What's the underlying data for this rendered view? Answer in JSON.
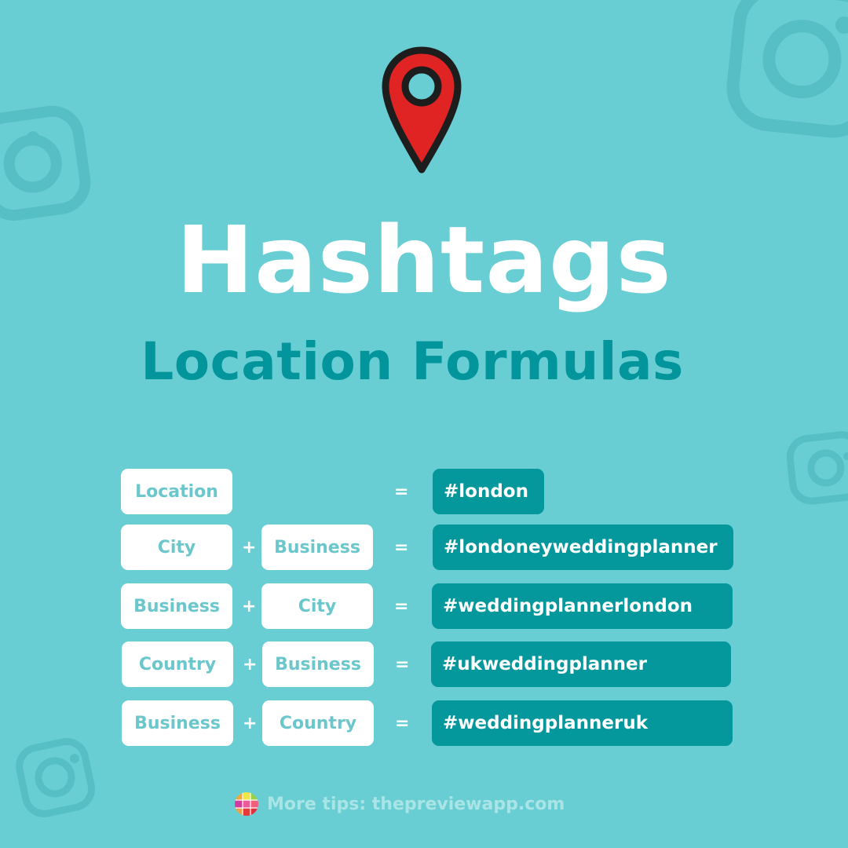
{
  "title": "Hashtags",
  "subtitle": "Location Formulas",
  "colors": {
    "background": "#68ced3",
    "accent_dark": "#04979c",
    "box_text": "#6bc7cc",
    "pin_red": "#e02424"
  },
  "icons": {
    "pin": "location-pin-icon",
    "background_icons": "instagram-icon",
    "footer_logo": "preview-app-logo-icon"
  },
  "formulas": [
    {
      "left": "Location",
      "op": "",
      "right": "",
      "equals": "=",
      "result": "#london"
    },
    {
      "left": "City",
      "op": "+",
      "right": "Business",
      "equals": "=",
      "result": "#londoneyweddingplanner"
    },
    {
      "left": "Business",
      "op": "+",
      "right": "City",
      "equals": "=",
      "result": "#weddingplannerlondon"
    },
    {
      "left": "Country",
      "op": "+",
      "right": "Business",
      "equals": "=",
      "result": "#ukweddingplanner"
    },
    {
      "left": "Business",
      "op": "+",
      "right": "Country",
      "equals": "=",
      "result": "#weddingplanneruk"
    }
  ],
  "footer": {
    "text": "More tips: thepreviewapp.com"
  }
}
